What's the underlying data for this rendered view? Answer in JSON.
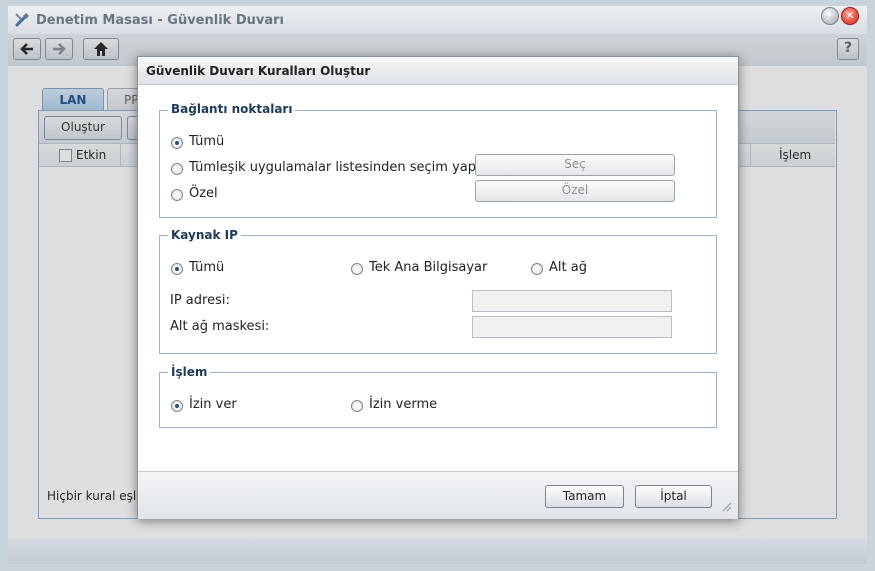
{
  "window": {
    "title": "Denetim Masası - Güvenlik Duvarı",
    "close_glyph": "✕"
  },
  "toolbar": {
    "back_icon": "arrow-left-icon",
    "forward_icon": "arrow-right-icon",
    "home_icon": "home-icon",
    "help_label": "?"
  },
  "tabs": [
    {
      "label": "LAN",
      "active": true
    },
    {
      "label": "PP",
      "active": false
    }
  ],
  "panel": {
    "create_button": "Oluştur",
    "columns": {
      "enabled": "Etkin",
      "action": "İşlem"
    },
    "empty_text": "Hiçbir kural eşle"
  },
  "dialog": {
    "title": "Güvenlik Duvarı Kuralları Oluştur",
    "ports": {
      "legend": "Bağlantı noktaları",
      "options": [
        "Tümü",
        "Tümleşik uygulamalar listesinden seçim yap",
        "Özel"
      ],
      "selected": 0,
      "select_button": "Seç",
      "custom_button": "Özel"
    },
    "source_ip": {
      "legend": "Kaynak IP",
      "options": [
        "Tümü",
        "Tek Ana Bilgisayar",
        "Alt ağ"
      ],
      "selected": 0,
      "ip_label": "IP adresi:",
      "ip_value": "",
      "mask_label": "Alt ağ maskesi:",
      "mask_value": ""
    },
    "action": {
      "legend": "İşlem",
      "options": [
        "İzin ver",
        "İzin verme"
      ],
      "selected": 0
    },
    "ok_button": "Tamam",
    "cancel_button": "İptal"
  },
  "colors": {
    "accent": "#1f4e82",
    "dialog_border": "#9ab5cf",
    "close_red": "#d5281a"
  }
}
